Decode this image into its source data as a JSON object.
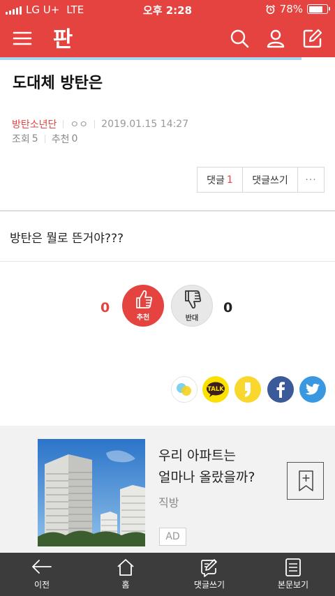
{
  "status_bar": {
    "carrier": "LG U+",
    "network": "LTE",
    "time": "오후 2:28",
    "battery": "78%",
    "battery_level": 0.78
  },
  "app": {
    "logo_text": "판",
    "brand_color": "#e5433f",
    "read_progress": 0.9
  },
  "post": {
    "title": "도대체 방탄은",
    "author": "방탄소년단",
    "author_sub": "ㅇㅇ",
    "date": "2019.01.15 14:27",
    "views_label": "조회",
    "views": "5",
    "recommend_label": "추천",
    "recommend": "0",
    "body": "방탄은 뭘로 뜬거야???"
  },
  "actions": {
    "comments_label": "댓글",
    "comments_count": "1",
    "write_label": "댓글쓰기",
    "more_label": "···"
  },
  "votes": {
    "up_count": "0",
    "up_label": "추천",
    "down_label": "반대",
    "down_count": "0"
  },
  "share": {
    "icons": [
      "band-icon",
      "kakaotalk-icon",
      "kakaostory-icon",
      "facebook-icon",
      "twitter-icon"
    ],
    "kakaotalk_text": "TALK"
  },
  "ad": {
    "title_line1": "우리 아파트는",
    "title_line2": "얼마나 올랐을까?",
    "source": "직방",
    "badge": "AD"
  },
  "bottom_nav": {
    "items": [
      {
        "label": "이전",
        "icon": "back-arrow-icon"
      },
      {
        "label": "홈",
        "icon": "home-icon"
      },
      {
        "label": "댓글쓰기",
        "icon": "write-comment-icon"
      },
      {
        "label": "본문보기",
        "icon": "document-icon"
      }
    ]
  }
}
